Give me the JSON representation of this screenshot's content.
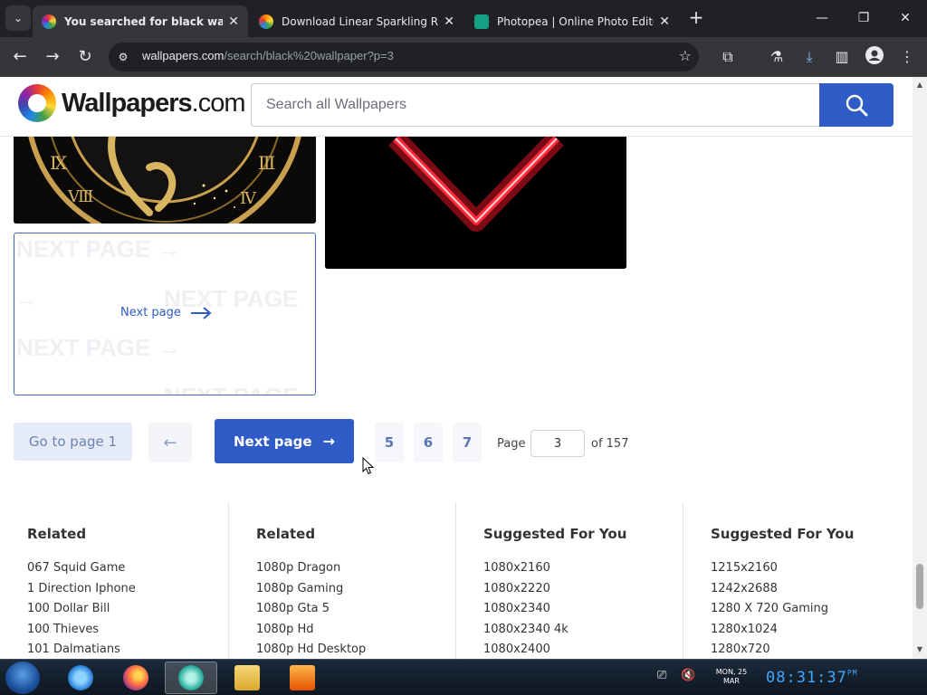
{
  "browser": {
    "tabs": [
      {
        "title": "You searched for black wallpap",
        "favicon_color": "#e53935"
      },
      {
        "title": "Download Linear Sparkling Ra",
        "favicon_color": "#fb8c00"
      },
      {
        "title": "Photopea | Online Photo Edito",
        "favicon_color": "#14a085"
      }
    ],
    "url_host": "wallpapers.com",
    "url_path": "/search/black%20wallpaper?p=3"
  },
  "site": {
    "logo_main": "Wallpapers",
    "logo_suffix": ".com",
    "search_placeholder": "Search all Wallpapers"
  },
  "next_card": {
    "label": "Next page",
    "ghost_text": "NEXT PAGE"
  },
  "pagination": {
    "first_label": "Go to page 1",
    "next_label": "Next page",
    "pages": [
      "5",
      "6",
      "7"
    ],
    "page_label": "Page",
    "current_page": "3",
    "of_label": "of 157"
  },
  "footer": {
    "columns": [
      {
        "title": "Related",
        "items": [
          "067 Squid Game",
          "1 Direction Iphone",
          "100 Dollar Bill",
          "100 Thieves",
          "101 Dalmatians"
        ]
      },
      {
        "title": "Related",
        "items": [
          "1080p Dragon",
          "1080p Gaming",
          "1080p Gta 5",
          "1080p Hd",
          "1080p Hd Desktop"
        ]
      },
      {
        "title": "Suggested For You",
        "items": [
          "1080x2160",
          "1080x2220",
          "1080x2340",
          "1080x2340 4k",
          "1080x2400"
        ]
      },
      {
        "title": "Suggested For You",
        "items": [
          "1215x2160",
          "1242x2688",
          "1280 X 720 Gaming",
          "1280x1024",
          "1280x720"
        ]
      }
    ]
  },
  "taskbar": {
    "date_line1": "MON, 25",
    "date_line2": "MAR",
    "time": "08:31:37",
    "ampm": "PM"
  },
  "colors": {
    "brand_blue": "#2e5bc6",
    "chrome_dark": "#202124",
    "chrome_toolbar": "#35363a"
  }
}
